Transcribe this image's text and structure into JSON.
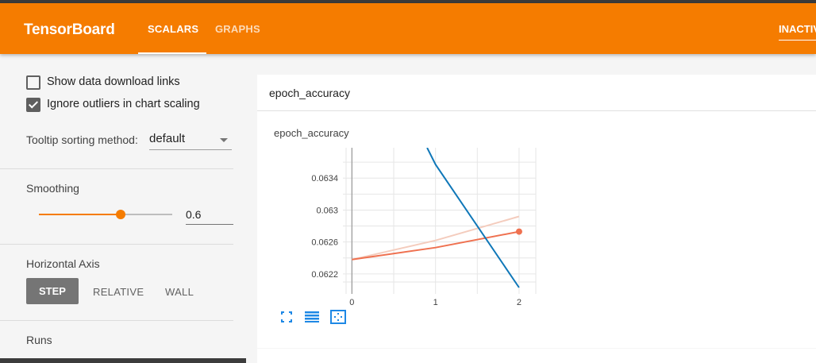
{
  "header": {
    "brand": "TensorBoard",
    "tabs": [
      {
        "label": "SCALARS",
        "active": true
      },
      {
        "label": "GRAPHS",
        "active": false
      }
    ],
    "status": "INACTIV",
    "color": "#f57c00"
  },
  "sidebar": {
    "show_download_links": {
      "label": "Show data download links",
      "checked": false
    },
    "ignore_outliers": {
      "label": "Ignore outliers in chart scaling",
      "checked": true
    },
    "tooltip_sorting": {
      "label": "Tooltip sorting method:",
      "value": "default"
    },
    "smoothing": {
      "label": "Smoothing",
      "value": "0.6",
      "fraction": 0.6
    },
    "horizontal_axis": {
      "label": "Horizontal Axis",
      "options": [
        "STEP",
        "RELATIVE",
        "WALL"
      ],
      "selected": "STEP"
    },
    "runs": {
      "label": "Runs"
    }
  },
  "card": {
    "header_title": "epoch_accuracy",
    "icons": [
      "fullscreen-icon",
      "list-icon",
      "fit-domain-icon"
    ]
  },
  "chart_data": {
    "type": "line",
    "title": "epoch_accuracy",
    "x_ticks": [
      "0",
      "1",
      "2"
    ],
    "y_ticks": [
      "0.0622",
      "0.0626",
      "0.063",
      "0.0634"
    ],
    "xlim": [
      -0.07,
      2.2
    ],
    "ylim": [
      0.06201,
      0.06378
    ],
    "grid": true,
    "series": [
      {
        "color": "#f4ccbd",
        "x": [
          0,
          1,
          2
        ],
        "y": [
          0.06238,
          0.06262,
          0.06292
        ]
      },
      {
        "color": "#ef7150",
        "x": [
          0,
          1,
          2
        ],
        "y": [
          0.06238,
          0.06253,
          0.06273
        ],
        "marker_last": true
      },
      {
        "color": "#0f77b8",
        "x": [
          0.9,
          1,
          2
        ],
        "y": [
          0.06378,
          0.06357,
          0.06203
        ]
      }
    ]
  }
}
